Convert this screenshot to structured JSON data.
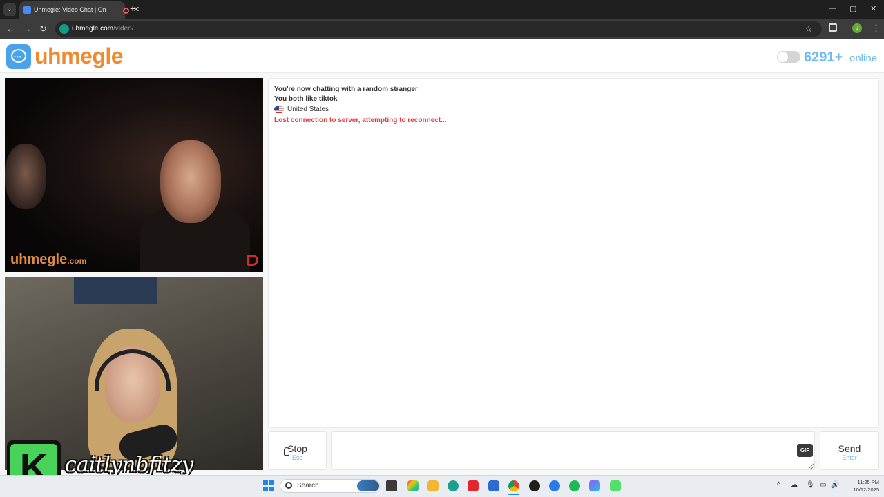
{
  "browser": {
    "tab_title": "Uhmegle: Video Chat | Ome",
    "url_host": "uhmegle.com",
    "url_path": "/video/",
    "profile_initial": "J"
  },
  "site": {
    "logo_text": "uhmegle",
    "online_count": "6291+",
    "online_label": "online"
  },
  "videos": {
    "stranger_watermark": "uhmegle",
    "stranger_watermark_suffix": ".com",
    "overlay_letter": "K",
    "overlay_name": "caitlynbfitzy"
  },
  "chat": {
    "messages": [
      "You're now chatting with a random stranger",
      "You both like tiktok"
    ],
    "country": "United States",
    "error": "Lost connection to server, attempting to reconnect..."
  },
  "controls": {
    "stop_label": "Stop",
    "stop_hint": "Esc",
    "gif_label": "GIF",
    "send_label": "Send",
    "send_hint": "Enter"
  },
  "taskbar": {
    "search_placeholder": "Search",
    "time": "11:25 PM",
    "date": "10/12/2025"
  },
  "colors": {
    "brand_orange": "#ef8a2f",
    "brand_blue": "#6cb8f2",
    "error_red": "#e63a3a"
  }
}
